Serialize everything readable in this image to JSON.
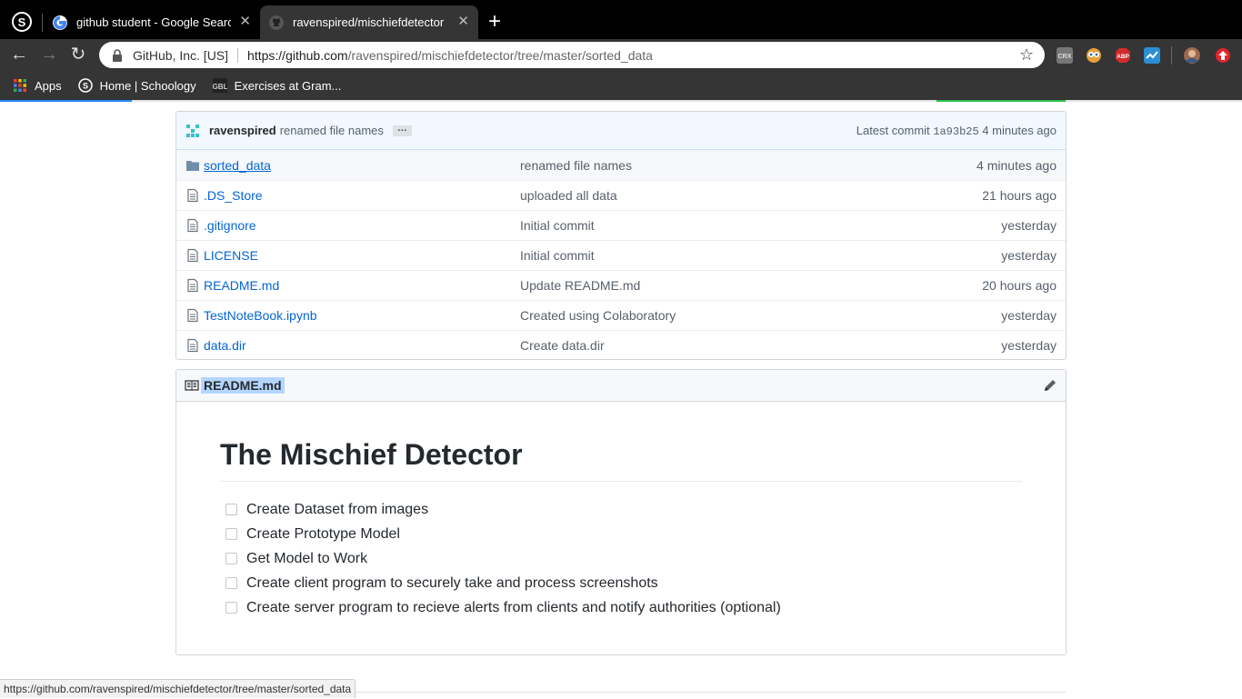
{
  "tabs": [
    {
      "title": "github student - Google Search",
      "favicon": "google-icon",
      "active": false
    },
    {
      "title": "ravenspired/mischiefdetector",
      "favicon": "github-icon",
      "active": true
    }
  ],
  "toolbar": {
    "org": "GitHub, Inc. [US]",
    "url_host": "https://github.com",
    "url_path": "/ravenspired/mischiefdetector/tree/master/sorted_data"
  },
  "bookmarks": [
    {
      "label": "Apps",
      "icon": "apps-grid-icon"
    },
    {
      "label": "Home | Schoology",
      "icon": "schoology-icon"
    },
    {
      "label": "Exercises at Gram...",
      "icon": "gbl-icon"
    }
  ],
  "commit": {
    "author": "ravenspired",
    "message": "renamed file names",
    "ellipsis": "…",
    "latest_label": "Latest commit",
    "sha": "1a93b25",
    "age": "4 minutes ago"
  },
  "files": [
    {
      "name": "sorted_data",
      "message": "renamed file names",
      "age": "4 minutes ago",
      "type": "dir"
    },
    {
      "name": ".DS_Store",
      "message": "uploaded all data",
      "age": "21 hours ago",
      "type": "file"
    },
    {
      "name": ".gitignore",
      "message": "Initial commit",
      "age": "yesterday",
      "type": "file"
    },
    {
      "name": "LICENSE",
      "message": "Initial commit",
      "age": "yesterday",
      "type": "file"
    },
    {
      "name": "README.md",
      "message": "Update README.md",
      "age": "20 hours ago",
      "type": "file"
    },
    {
      "name": "TestNoteBook.ipynb",
      "message": "Created using Colaboratory",
      "age": "yesterday",
      "type": "file"
    },
    {
      "name": "data.dir",
      "message": "Create data.dir",
      "age": "yesterday",
      "type": "file"
    }
  ],
  "readme": {
    "filename": "README.md",
    "title": "The Mischief Detector",
    "tasks": [
      "Create Dataset from images",
      "Create Prototype Model",
      "Get Model to Work",
      "Create client program to securely take and process screenshots",
      "Create server program to recieve alerts from clients and notify authorities (optional)"
    ]
  },
  "status_url": "https://github.com/ravenspired/mischiefdetector/tree/master/sorted_data",
  "colors": {
    "link": "#0366d6",
    "commit_bg": "#f1f8ff",
    "selection": "#b4d5fe"
  }
}
